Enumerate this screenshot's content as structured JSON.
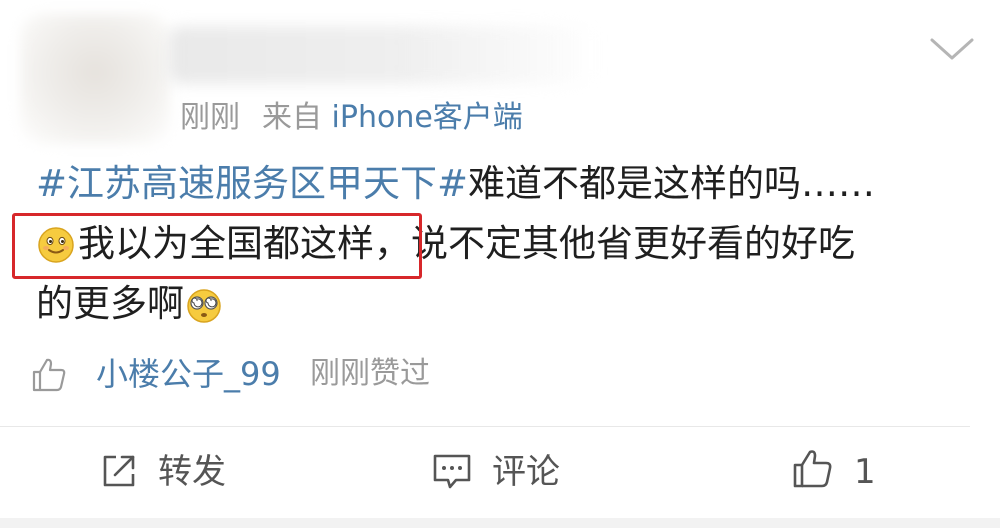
{
  "header": {
    "time": "刚刚",
    "source_prefix": "来自",
    "client": "iPhone客户端"
  },
  "content": {
    "line1_topic": "#江苏高速服务区甲天下#",
    "line1_text": "难道不都是这样的吗……",
    "line2_highlighted": "我以为全国都这样",
    "line2_rest": "，说不定其他省更好看的好吃",
    "line3_text": "的更多啊",
    "emoji_1": "smile-emoji",
    "emoji_2": "dizzy-eyes-emoji"
  },
  "like_info": {
    "user": "小楼公子_99",
    "status": "刚刚赞过"
  },
  "actions": {
    "repost_label": "转发",
    "comment_label": "评论",
    "like_count": "1"
  },
  "colors": {
    "link_blue": "#4b7dab",
    "highlight_red": "#d7272a",
    "meta_gray": "#9a9a9a"
  }
}
